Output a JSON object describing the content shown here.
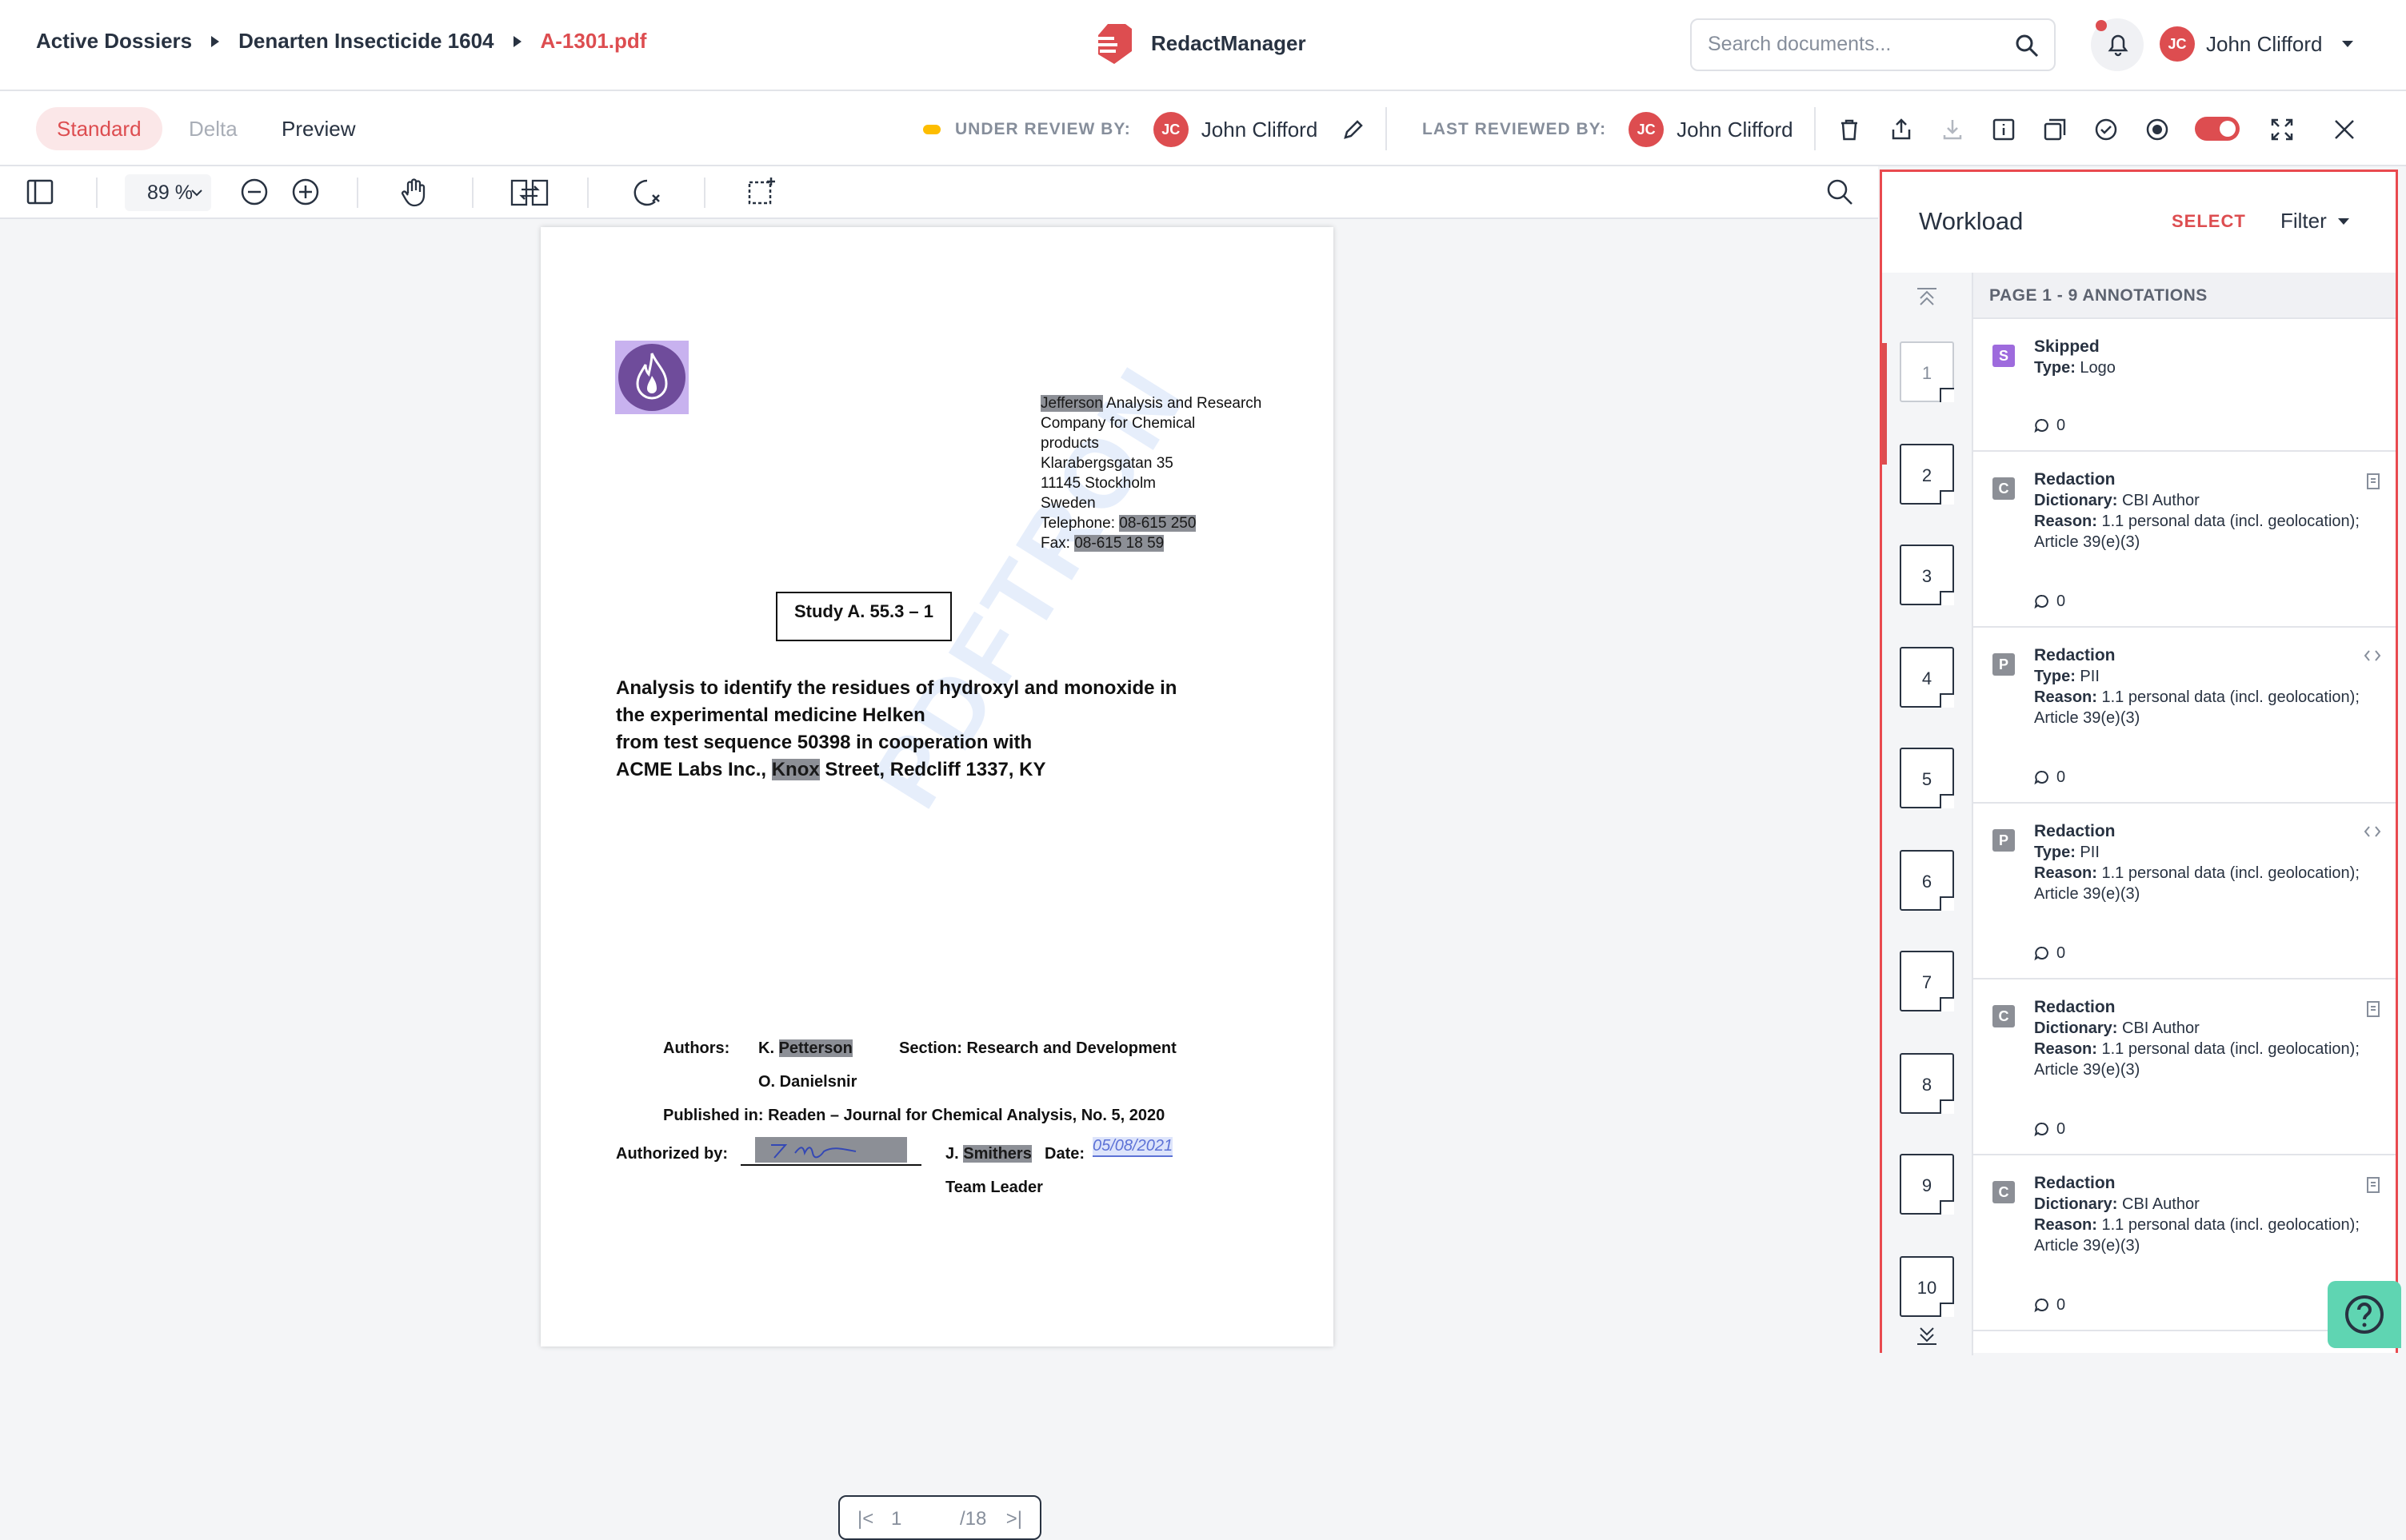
{
  "breadcrumb": {
    "items": [
      "Active Dossiers",
      "Denarten Insecticide 1604"
    ],
    "current": "A-1301.pdf"
  },
  "app": {
    "name": "RedactManager"
  },
  "search": {
    "placeholder": "Search documents..."
  },
  "user": {
    "initials": "JC",
    "name": "John Clifford"
  },
  "views": {
    "standard": "Standard",
    "delta": "Delta",
    "preview": "Preview"
  },
  "review": {
    "under_label": "UNDER REVIEW BY:",
    "under_initials": "JC",
    "under_name": "John Clifford",
    "last_label": "LAST REVIEWED BY:",
    "last_initials": "JC",
    "last_name": "John Clifford"
  },
  "toolbar": {
    "zoom": "89 %"
  },
  "document": {
    "addr_company": "Jefferson",
    "addr_line1_rest": " Analysis and Research",
    "addr_lines": [
      "Company for Chemical",
      "products",
      "Klarabergsgatan 35",
      "11145 Stockholm",
      "Sweden"
    ],
    "tel_label": "Telephone: ",
    "tel": "08-615 250",
    "fax_label": "Fax: ",
    "fax": "08-615 18 59",
    "study": "Study A. 55.3 – 1",
    "title_lines": [
      "Analysis to identify the residues of hydroxyl and monoxide in",
      "the experimental medicine Helken",
      "from test sequence 50398 in cooperation with"
    ],
    "title_last_a": "ACME Labs Inc., ",
    "title_last_hl": "Knox",
    "title_last_b": " Street, Redcliff 1337, KY",
    "authors_label": "Authors:",
    "author1_a": "K. ",
    "author1_hl": "Petterson",
    "section": "Section: Research and Development",
    "author2": "O. Danielsnir",
    "published": "Published in: Readen – Journal for Chemical Analysis, No. 5, 2020",
    "authorized_label": "Authorized by:",
    "signer_a": "J. ",
    "signer_hl": "Smithers",
    "date_label": "Date:",
    "date_value": "05/08/2021",
    "team_leader": "Team Leader",
    "page_current": "1",
    "page_total": "/18"
  },
  "workload": {
    "title": "Workload",
    "select": "SELECT",
    "filter": "Filter",
    "page_header": "PAGE 1 - 9 ANNOTATIONS",
    "pages": [
      "1",
      "2",
      "3",
      "4",
      "5",
      "6",
      "7",
      "8",
      "9",
      "10"
    ],
    "annotations": [
      {
        "badge": "S",
        "badge_color": "#9e6bdd",
        "type": "Skipped",
        "l1k": "Type:",
        "l1v": " Logo",
        "r1": "",
        "r2": "",
        "comments": "0",
        "icon": "none"
      },
      {
        "badge": "C",
        "badge_color": "#8c8f96",
        "type": "Redaction",
        "l1k": "Dictionary:",
        "l1v": " CBI Author",
        "r1": "Reason:",
        "r2": " 1.1 personal data (incl. geolocation); Article 39(e)(3)",
        "comments": "0",
        "icon": "document-icon"
      },
      {
        "badge": "P",
        "badge_color": "#8c8f96",
        "type": "Redaction",
        "l1k": "Type:",
        "l1v": " PII",
        "r1": "Reason:",
        "r2": " 1.1 personal data (incl. geolocation); Article 39(e)(3)",
        "comments": "0",
        "icon": "code-icon"
      },
      {
        "badge": "P",
        "badge_color": "#8c8f96",
        "type": "Redaction",
        "l1k": "Type:",
        "l1v": " PII",
        "r1": "Reason:",
        "r2": " 1.1 personal data (incl. geolocation); Article 39(e)(3)",
        "comments": "0",
        "icon": "code-icon"
      },
      {
        "badge": "C",
        "badge_color": "#8c8f96",
        "type": "Redaction",
        "l1k": "Dictionary:",
        "l1v": " CBI Author",
        "r1": "Reason:",
        "r2": " 1.1 personal data (incl. geolocation); Article 39(e)(3)",
        "comments": "0",
        "icon": "document-icon"
      },
      {
        "badge": "C",
        "badge_color": "#8c8f96",
        "type": "Redaction",
        "l1k": "Dictionary:",
        "l1v": " CBI Author",
        "r1": "Reason:",
        "r2": " 1.1 personal data (incl. geolocation); Article 39(e)(3)",
        "comments": "0",
        "icon": "document-icon"
      }
    ]
  }
}
